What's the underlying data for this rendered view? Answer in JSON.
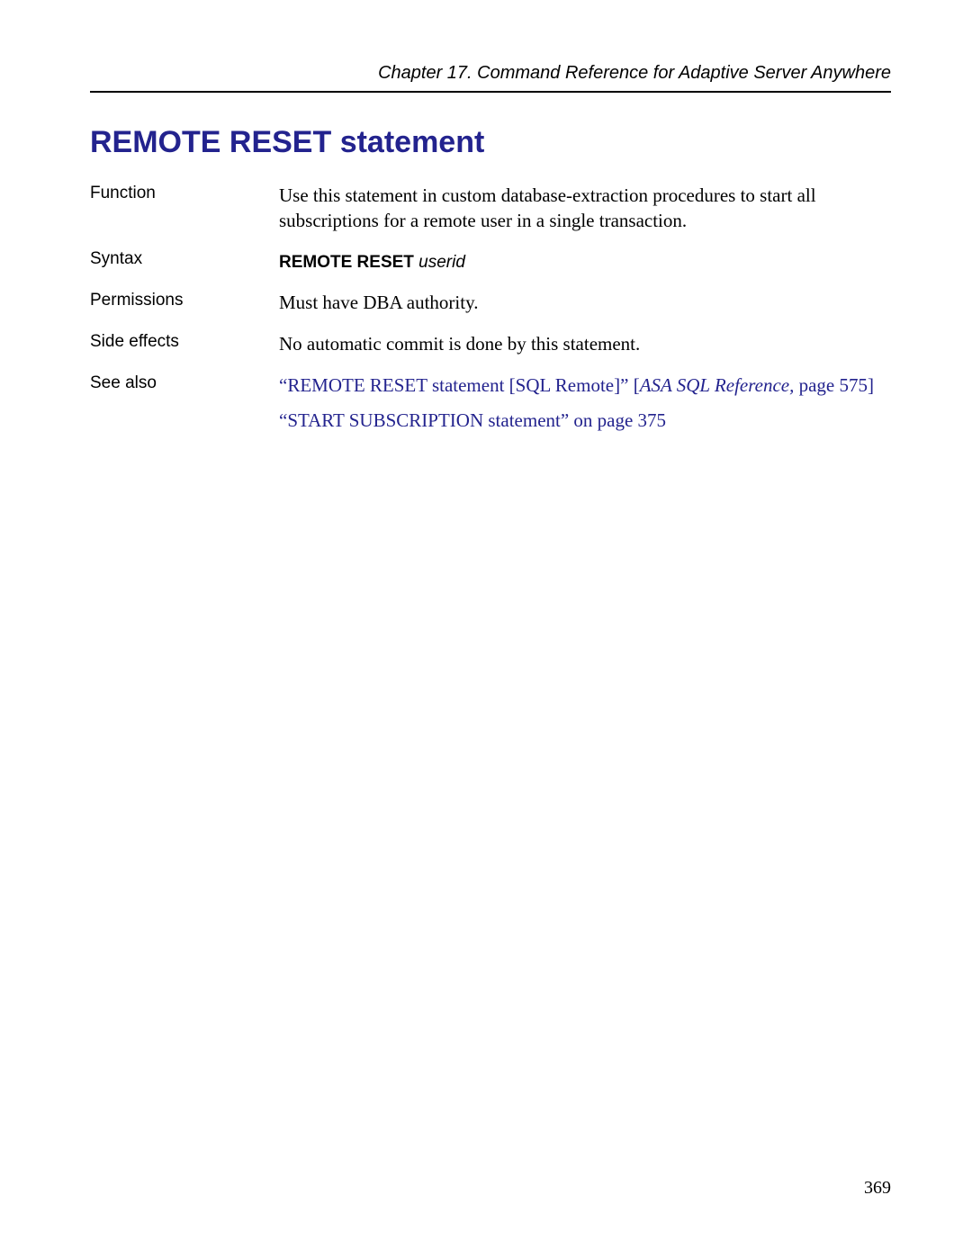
{
  "header": {
    "running_title": "Chapter 17.  Command Reference for Adaptive Server Anywhere"
  },
  "heading": "REMOTE RESET statement",
  "entries": {
    "function": {
      "label": "Function",
      "text": "Use this statement in custom database-extraction procedures to start all subscriptions for a remote user in a single transaction."
    },
    "syntax": {
      "label": "Syntax",
      "keyword": "REMOTE RESET",
      "param": "userid"
    },
    "permissions": {
      "label": "Permissions",
      "text": "Must have DBA authority."
    },
    "side_effects": {
      "label": "Side effects",
      "text": "No automatic commit is done by this statement."
    },
    "see_also": {
      "label": "See also",
      "link1_quoted": "“REMOTE RESET statement [SQL Remote]”",
      "link1_ref_open": " [",
      "link1_ref_title": "ASA SQL Reference,",
      "link1_ref_page": " page 575]",
      "link2": "“START SUBSCRIPTION statement” on page 375"
    }
  },
  "page_number": "369"
}
